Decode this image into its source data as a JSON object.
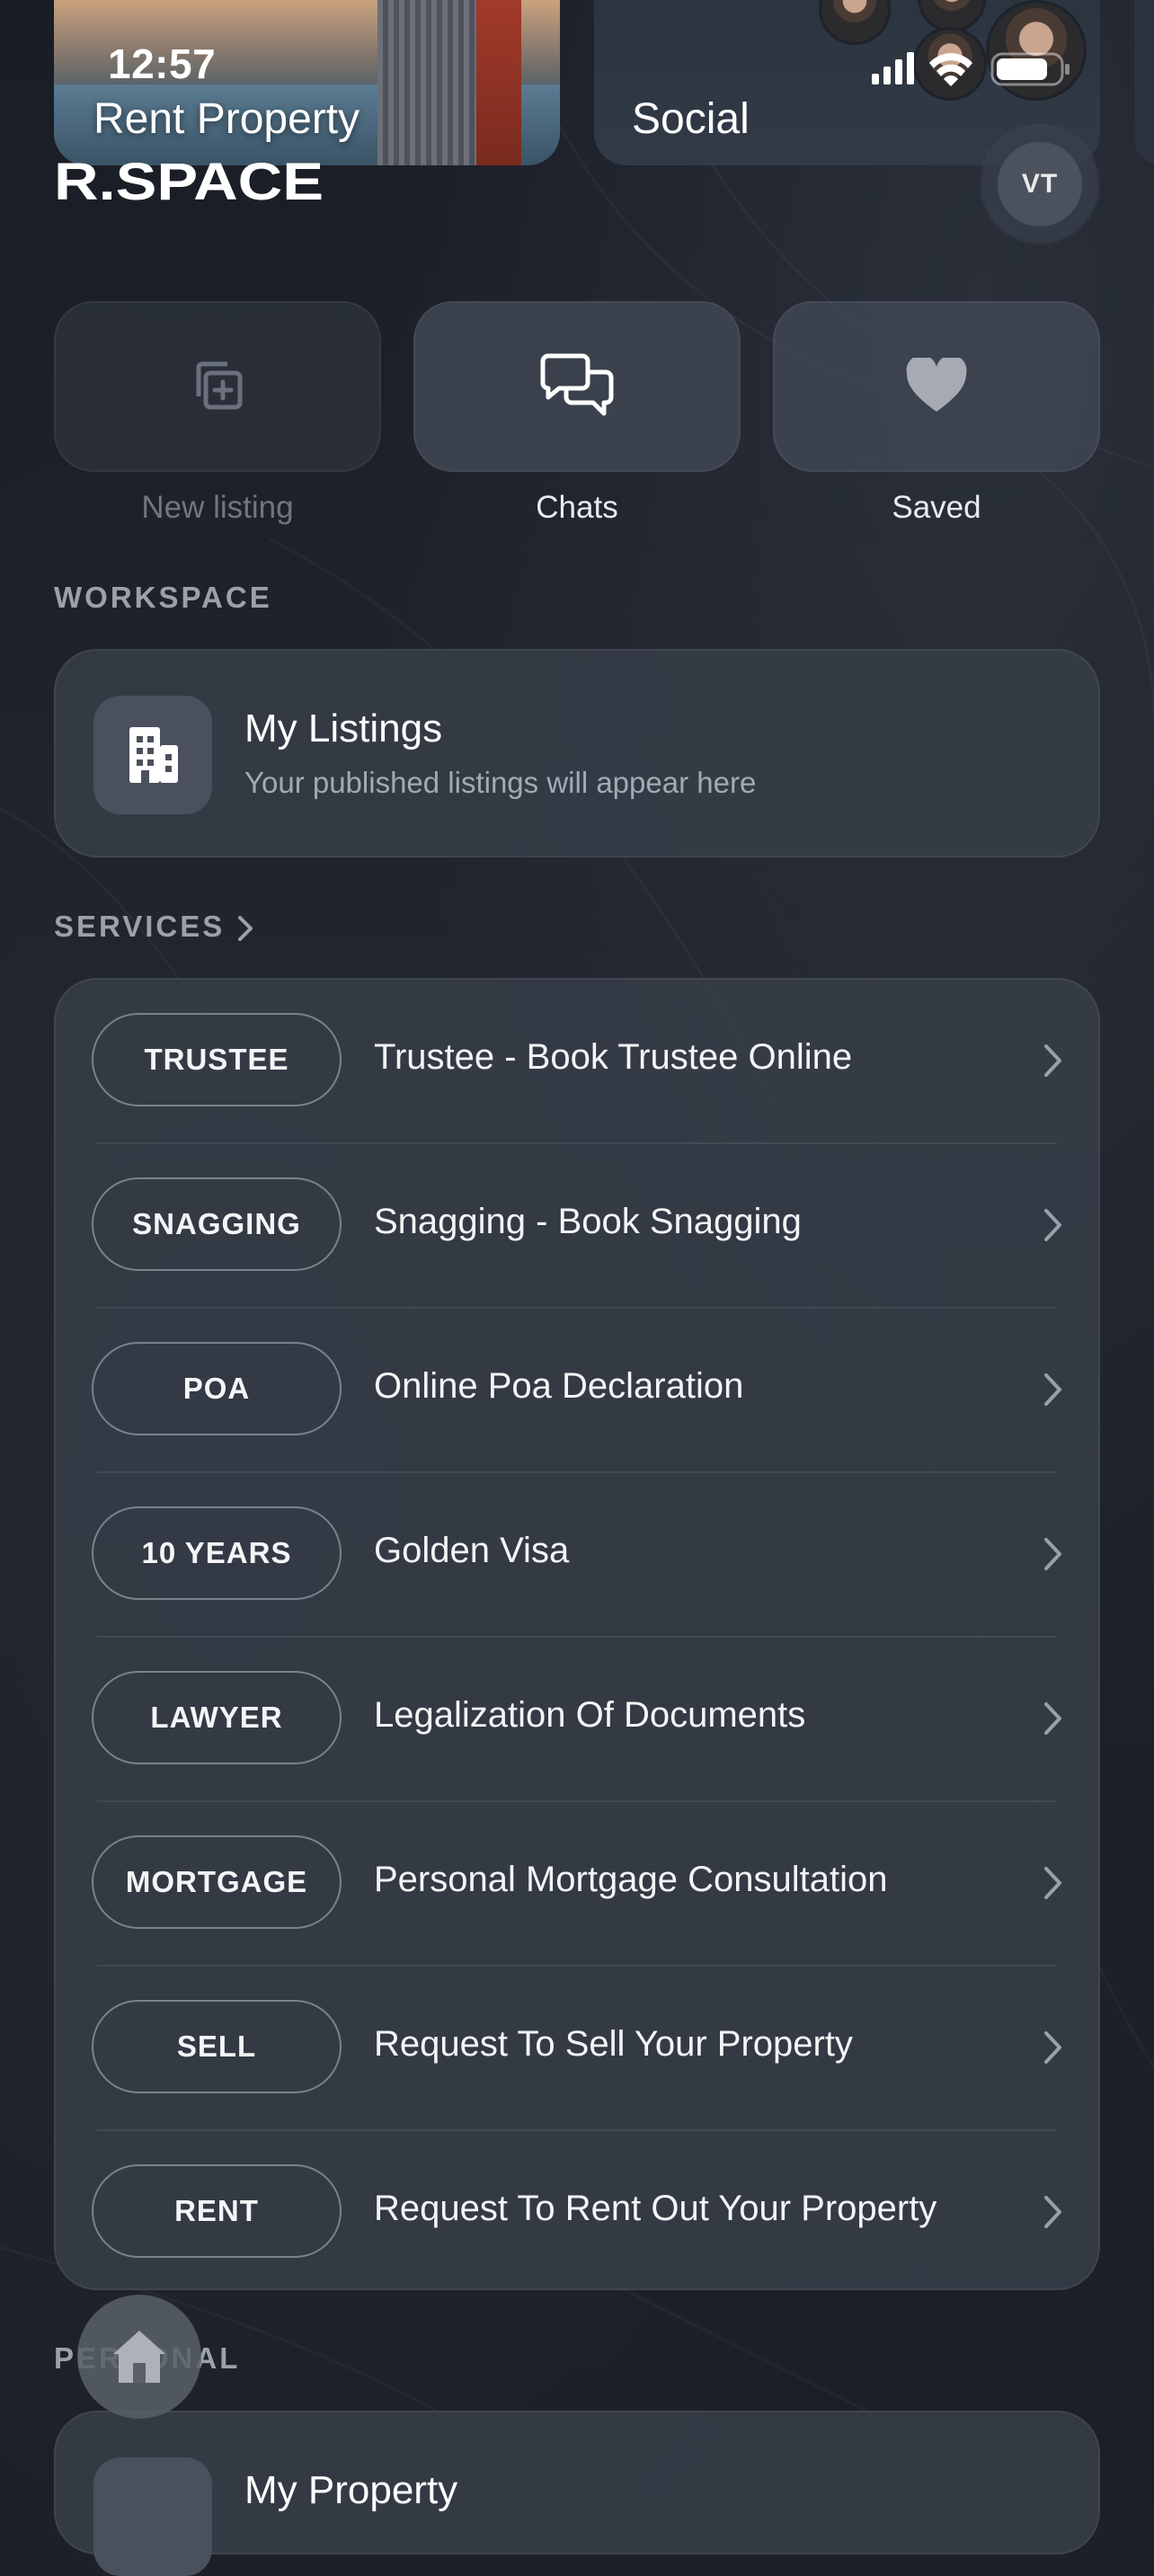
{
  "status_bar": {
    "time": "12:57"
  },
  "top_cards": [
    {
      "title": "Rent Property"
    },
    {
      "title": "Social"
    }
  ],
  "brand": {
    "logo_text": "R.SPACE"
  },
  "profile": {
    "initials": "VT"
  },
  "quick_actions": [
    {
      "label": "New listing",
      "icon": "add-listing-icon",
      "enabled": false
    },
    {
      "label": "Chats",
      "icon": "chat-bubbles-icon",
      "enabled": true
    },
    {
      "label": "Saved",
      "icon": "heart-icon",
      "enabled": true
    }
  ],
  "workspace": {
    "section_label": "WORKSPACE",
    "listings_title": "My Listings",
    "listings_subtitle": "Your published listings will appear here"
  },
  "services": {
    "section_label": "SERVICES",
    "items": [
      {
        "tag": "TRUSTEE",
        "label": "Trustee - Book Trustee Online"
      },
      {
        "tag": "SNAGGING",
        "label": "Snagging - Book Snagging"
      },
      {
        "tag": "POA",
        "label": "Online Poa Declaration"
      },
      {
        "tag": "10 YEARS",
        "label": "Golden Visa"
      },
      {
        "tag": "LAWYER",
        "label": "Legalization Of Documents"
      },
      {
        "tag": "MORTGAGE",
        "label": "Personal Mortgage Consultation"
      },
      {
        "tag": "SELL",
        "label": "Request To Sell Your Property"
      },
      {
        "tag": "RENT",
        "label": "Request To Rent Out Your Property"
      }
    ]
  },
  "personal": {
    "section_label": "PERSONAL",
    "property_title": "My Property"
  },
  "colors": {
    "background": "#1c2029",
    "panel": "#373d48",
    "muted_text": "#9ba1ab",
    "pill_border": "#7b818b"
  }
}
